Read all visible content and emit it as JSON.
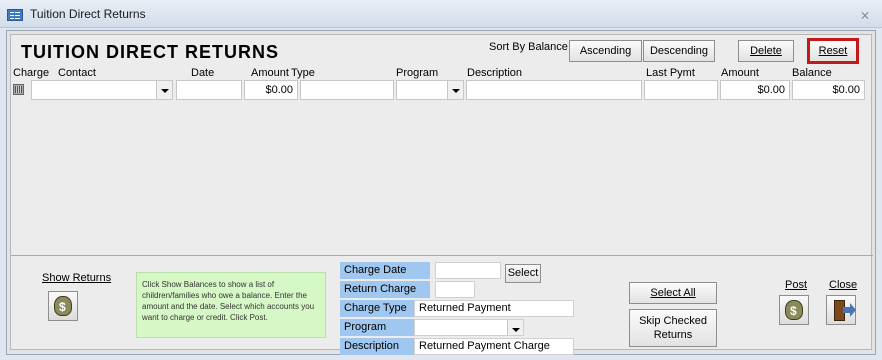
{
  "window": {
    "title": "Tuition Direct Returns",
    "close_glyph": "⨯"
  },
  "header": {
    "title": "TUITION DIRECT RETURNS",
    "sort_label": "Sort By Balance"
  },
  "buttons": {
    "ascending": "Ascending",
    "descending": "Descending",
    "delete": "Delete",
    "reset": "Reset",
    "select": "Select",
    "select_all": "Select All",
    "skip_checked_line1": "Skip Checked",
    "skip_checked_line2": "Returns",
    "show_returns": "Show Returns",
    "post": "Post",
    "close": "Close"
  },
  "columns": {
    "charge": "Charge",
    "contact": "Contact",
    "date": "Date",
    "amount": "Amount",
    "type": "Type",
    "program": "Program",
    "description": "Description",
    "last_pymt": "Last Pymt",
    "amount2": "Amount",
    "balance": "Balance"
  },
  "row": {
    "contact": "",
    "date": "",
    "amount": "$0.00",
    "type": "",
    "program": "",
    "description": "",
    "last_pymt": "",
    "amount2": "$0.00",
    "balance": "$0.00"
  },
  "instructions": "Click Show Balances to show a list of children/families who owe a balance. Enter the amount and the date. Select which accounts you want to charge or credit. Click Post.",
  "charge_panel": {
    "charge_date_label": "Charge Date",
    "charge_date_value": "",
    "return_charge_label": "Return Charge",
    "return_charge_value": "",
    "charge_type_label": "Charge Type",
    "charge_type_value": "Returned Payment",
    "program_label": "Program",
    "program_value": "",
    "description_label": "Description",
    "description_value": "Returned Payment Charge"
  },
  "colors": {
    "reset_border": "#c01a1a",
    "info_bg": "#d6f8c6",
    "label_blue": "#9fc7ef"
  },
  "icons": [
    "app-icon",
    "close-icon",
    "dropdown-arrow-icon",
    "money-bag-icon",
    "exit-door-icon"
  ]
}
